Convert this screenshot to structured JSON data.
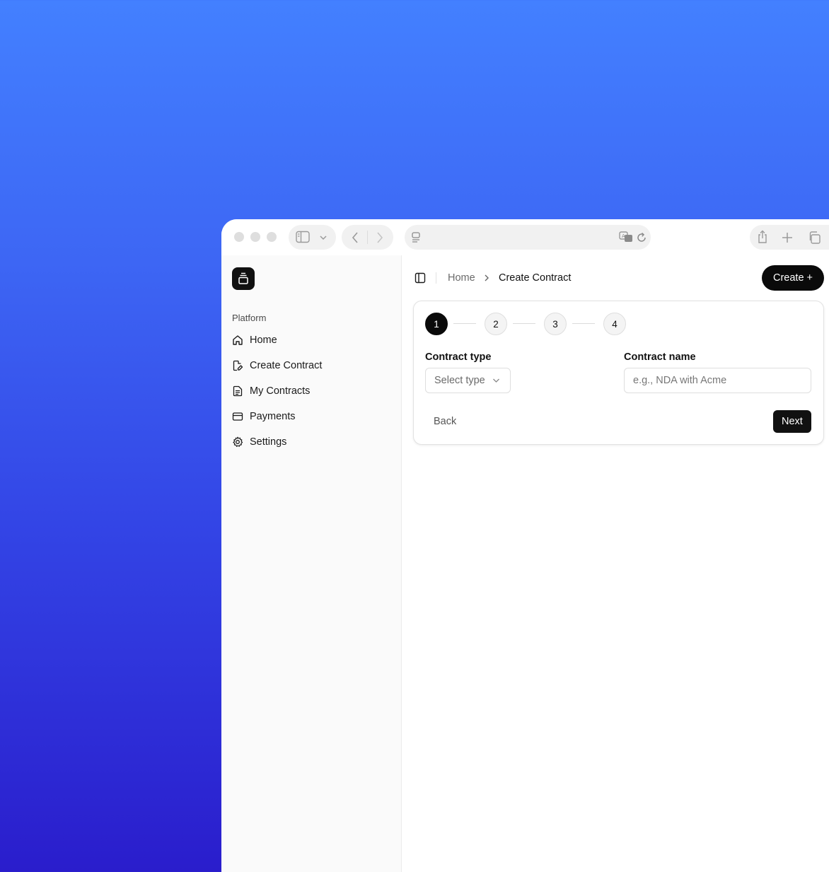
{
  "browser": {
    "icons": [
      "sidebar-toggle-icon",
      "chevron-down-icon",
      "back-arrow-icon",
      "forward-arrow-icon",
      "page-menu-icon",
      "translate-icon",
      "reload-icon",
      "share-icon",
      "new-tab-icon",
      "tabs-overview-icon"
    ]
  },
  "sidebar": {
    "group_label": "Platform",
    "items": [
      {
        "label": "Home",
        "icon": "home-icon"
      },
      {
        "label": "Create Contract",
        "icon": "edit-document-icon"
      },
      {
        "label": "My Contracts",
        "icon": "document-icon"
      },
      {
        "label": "Payments",
        "icon": "credit-card-icon"
      },
      {
        "label": "Settings",
        "icon": "gear-icon"
      }
    ]
  },
  "header": {
    "breadcrumb": {
      "home": "Home",
      "current": "Create Contract"
    },
    "create_button": "Create +"
  },
  "wizard": {
    "steps": [
      "1",
      "2",
      "3",
      "4"
    ],
    "active_step": 1,
    "contract_type": {
      "label": "Contract type",
      "placeholder": "Select type"
    },
    "contract_name": {
      "label": "Contract name",
      "placeholder": "e.g., NDA with Acme",
      "value": ""
    },
    "back_label": "Back",
    "next_label": "Next"
  },
  "colors": {
    "accent": "#0a0a0a",
    "background_top": "#4380ff",
    "background_bottom": "#2a1dcc"
  }
}
